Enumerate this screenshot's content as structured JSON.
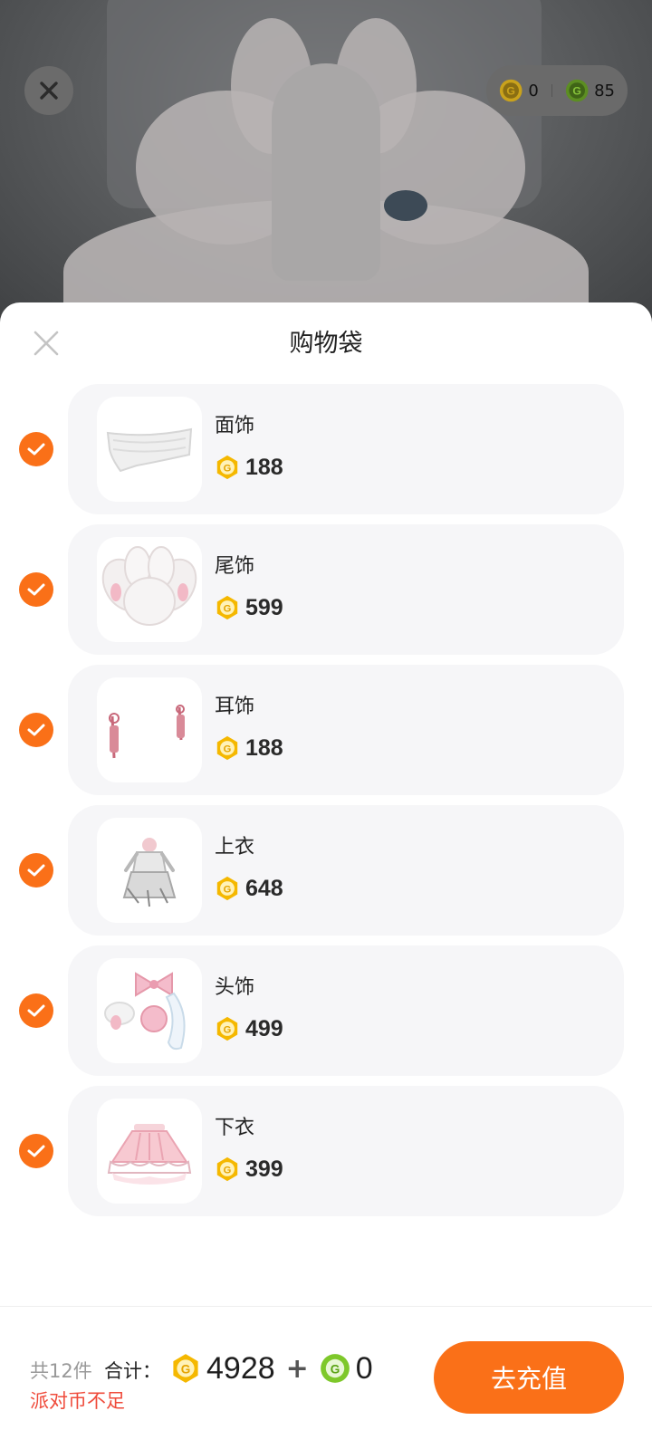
{
  "header": {
    "wallet": {
      "gold_amount": "0",
      "green_amount": "85"
    }
  },
  "sheet": {
    "title": "购物袋",
    "items": [
      {
        "name": "面饰",
        "price": "188",
        "checked": true
      },
      {
        "name": "尾饰",
        "price": "599",
        "checked": true
      },
      {
        "name": "耳饰",
        "price": "188",
        "checked": true
      },
      {
        "name": "上衣",
        "price": "648",
        "checked": true
      },
      {
        "name": "头饰",
        "price": "499",
        "checked": true
      },
      {
        "name": "下衣",
        "price": "399",
        "checked": true
      }
    ]
  },
  "footer": {
    "count_label": "共12件",
    "total_label": "合计：",
    "gold_total": "4928",
    "plus": "+",
    "green_total": "0",
    "warning": "派对币不足",
    "recharge_label": "去充值"
  },
  "colors": {
    "accent": "#fa7018",
    "warning": "#ef4b3b",
    "gold_coin": "#f5b800",
    "green_coin": "#7ec82a"
  }
}
